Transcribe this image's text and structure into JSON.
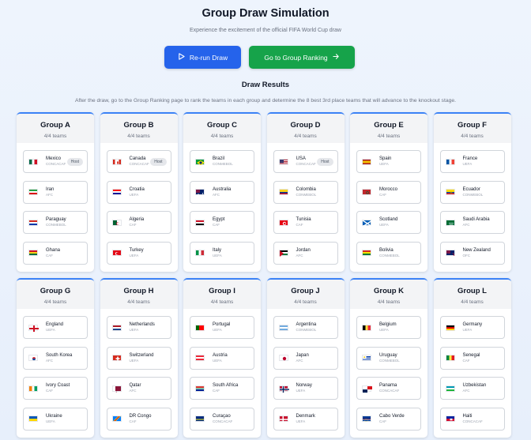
{
  "header": {
    "title": "Group Draw Simulation",
    "subtitle": "Experience the excitement of the official FIFA World Cup draw"
  },
  "buttons": {
    "rerun_label": "Re-run Draw",
    "ranking_label": "Go to Group Ranking",
    "rerun_color": "#2563eb",
    "ranking_color": "#16a34a"
  },
  "results": {
    "title": "Draw Results",
    "instructions": "After the draw, go to the Group Ranking page to rank the teams in each group and determine the 8 best 3rd place teams that will advance to the knockout stage."
  },
  "groups": [
    {
      "name": "Group A",
      "count": "4/4 teams",
      "teams": [
        {
          "name": "Mexico",
          "conf": "CONCACAF",
          "badge": "Host",
          "flag": "mexico"
        },
        {
          "name": "Iran",
          "conf": "AFC",
          "flag": "iran"
        },
        {
          "name": "Paraguay",
          "conf": "CONMEBOL",
          "flag": "paraguay"
        },
        {
          "name": "Ghana",
          "conf": "CAF",
          "flag": "ghana"
        }
      ]
    },
    {
      "name": "Group B",
      "count": "4/4 teams",
      "teams": [
        {
          "name": "Canada",
          "conf": "CONCACAF",
          "badge": "Host",
          "flag": "canada"
        },
        {
          "name": "Croatia",
          "conf": "UEFA",
          "flag": "croatia"
        },
        {
          "name": "Algeria",
          "conf": "CAF",
          "flag": "algeria"
        },
        {
          "name": "Turkey",
          "conf": "UEFA",
          "flag": "turkey"
        }
      ]
    },
    {
      "name": "Group C",
      "count": "4/4 teams",
      "teams": [
        {
          "name": "Brazil",
          "conf": "CONMEBOL",
          "flag": "brazil"
        },
        {
          "name": "Australia",
          "conf": "AFC",
          "flag": "australia"
        },
        {
          "name": "Egypt",
          "conf": "CAF",
          "flag": "egypt"
        },
        {
          "name": "Italy",
          "conf": "UEFA",
          "flag": "italy"
        }
      ]
    },
    {
      "name": "Group D",
      "count": "4/4 teams",
      "teams": [
        {
          "name": "USA",
          "conf": "CONCACAF",
          "badge": "Host",
          "flag": "usa"
        },
        {
          "name": "Colombia",
          "conf": "CONMEBOL",
          "flag": "colombia"
        },
        {
          "name": "Tunisia",
          "conf": "CAF",
          "flag": "tunisia"
        },
        {
          "name": "Jordan",
          "conf": "AFC",
          "flag": "jordan"
        }
      ]
    },
    {
      "name": "Group E",
      "count": "4/4 teams",
      "teams": [
        {
          "name": "Spain",
          "conf": "UEFA",
          "flag": "spain"
        },
        {
          "name": "Morocco",
          "conf": "CAF",
          "flag": "morocco"
        },
        {
          "name": "Scotland",
          "conf": "UEFA",
          "flag": "scotland"
        },
        {
          "name": "Bolivia",
          "conf": "CONMEBOL",
          "flag": "bolivia"
        }
      ]
    },
    {
      "name": "Group F",
      "count": "4/4 teams",
      "teams": [
        {
          "name": "France",
          "conf": "UEFA",
          "flag": "france"
        },
        {
          "name": "Ecuador",
          "conf": "CONMEBOL",
          "flag": "ecuador"
        },
        {
          "name": "Saudi Arabia",
          "conf": "AFC",
          "flag": "saudi"
        },
        {
          "name": "New Zealand",
          "conf": "OFC",
          "flag": "newzealand"
        }
      ]
    },
    {
      "name": "Group G",
      "count": "4/4 teams",
      "teams": [
        {
          "name": "England",
          "conf": "UEFA",
          "flag": "england"
        },
        {
          "name": "South Korea",
          "conf": "AFC",
          "flag": "southkorea"
        },
        {
          "name": "Ivory Coast",
          "conf": "CAF",
          "flag": "ivorycoast"
        },
        {
          "name": "Ukraine",
          "conf": "UEFA",
          "flag": "ukraine"
        }
      ]
    },
    {
      "name": "Group H",
      "count": "4/4 teams",
      "teams": [
        {
          "name": "Netherlands",
          "conf": "UEFA",
          "flag": "netherlands"
        },
        {
          "name": "Switzerland",
          "conf": "UEFA",
          "flag": "switzerland"
        },
        {
          "name": "Qatar",
          "conf": "AFC",
          "flag": "qatar"
        },
        {
          "name": "DR Congo",
          "conf": "CAF",
          "flag": "drcongo"
        }
      ]
    },
    {
      "name": "Group I",
      "count": "4/4 teams",
      "teams": [
        {
          "name": "Portugal",
          "conf": "UEFA",
          "flag": "portugal"
        },
        {
          "name": "Austria",
          "conf": "UEFA",
          "flag": "austria"
        },
        {
          "name": "South Africa",
          "conf": "CAF",
          "flag": "southafrica"
        },
        {
          "name": "Curaçao",
          "conf": "CONCACAF",
          "flag": "curacao"
        }
      ]
    },
    {
      "name": "Group J",
      "count": "4/4 teams",
      "teams": [
        {
          "name": "Argentina",
          "conf": "CONMEBOL",
          "flag": "argentina"
        },
        {
          "name": "Japan",
          "conf": "AFC",
          "flag": "japan"
        },
        {
          "name": "Norway",
          "conf": "UEFA",
          "flag": "norway"
        },
        {
          "name": "Denmark",
          "conf": "UEFA",
          "flag": "denmark"
        }
      ]
    },
    {
      "name": "Group K",
      "count": "4/4 teams",
      "teams": [
        {
          "name": "Belgium",
          "conf": "UEFA",
          "flag": "belgium"
        },
        {
          "name": "Uruguay",
          "conf": "CONMEBOL",
          "flag": "uruguay"
        },
        {
          "name": "Panama",
          "conf": "CONCACAF",
          "flag": "panama"
        },
        {
          "name": "Cabo Verde",
          "conf": "CAF",
          "flag": "caboverde"
        }
      ]
    },
    {
      "name": "Group L",
      "count": "4/4 teams",
      "teams": [
        {
          "name": "Germany",
          "conf": "UEFA",
          "flag": "germany"
        },
        {
          "name": "Senegal",
          "conf": "CAF",
          "flag": "senegal"
        },
        {
          "name": "Uzbekistan",
          "conf": "AFC",
          "flag": "uzbekistan"
        },
        {
          "name": "Haiti",
          "conf": "CONCACAF",
          "flag": "haiti"
        }
      ]
    }
  ]
}
